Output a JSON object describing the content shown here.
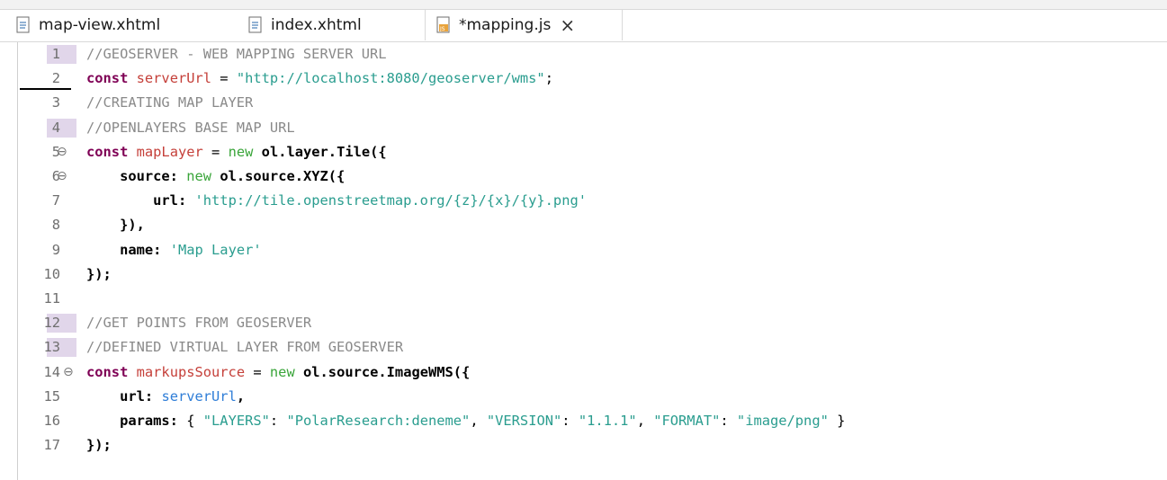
{
  "tabs": [
    {
      "label": "map-view.xhtml",
      "icon": "xhtml-file-icon",
      "active": false
    },
    {
      "label": "index.xhtml",
      "icon": "xhtml-file-icon",
      "active": false
    },
    {
      "label": "*mapping.js",
      "icon": "js-file-icon",
      "active": true,
      "close": "×"
    }
  ],
  "lines": [
    {
      "n": "1",
      "marked": true,
      "fold": "",
      "tokens": [
        {
          "t": "//GEOSERVER - WEB MAPPING SERVER URL",
          "c": "t-cmt"
        }
      ]
    },
    {
      "n": "2",
      "marked": false,
      "underline": true,
      "fold": "",
      "tokens": [
        {
          "t": "const",
          "c": "t-kw"
        },
        {
          "t": " "
        },
        {
          "t": "serverUrl",
          "c": "t-var"
        },
        {
          "t": " = "
        },
        {
          "t": "\"http://localhost:8080/geoserver/wms\"",
          "c": "t-str"
        },
        {
          "t": ";"
        }
      ]
    },
    {
      "n": "3",
      "marked": false,
      "fold": "",
      "tokens": [
        {
          "t": "//CREATING MAP LAYER",
          "c": "t-cmt"
        }
      ]
    },
    {
      "n": "4",
      "marked": true,
      "fold": "",
      "tokens": [
        {
          "t": "//OPENLAYERS BASE MAP URL",
          "c": "t-cmt"
        }
      ]
    },
    {
      "n": "5",
      "marked": false,
      "fold": "⊖",
      "tokens": [
        {
          "t": "const",
          "c": "t-kw"
        },
        {
          "t": " "
        },
        {
          "t": "mapLayer",
          "c": "t-var"
        },
        {
          "t": " = "
        },
        {
          "t": "new",
          "c": "t-new"
        },
        {
          "t": " "
        },
        {
          "t": "ol.layer.Tile({",
          "c": "t-id"
        }
      ]
    },
    {
      "n": "6",
      "marked": false,
      "fold": "⊖",
      "tokens": [
        {
          "t": "    "
        },
        {
          "t": "source:",
          "c": "t-id"
        },
        {
          "t": " "
        },
        {
          "t": "new",
          "c": "t-new"
        },
        {
          "t": " "
        },
        {
          "t": "ol.source.XYZ({",
          "c": "t-id"
        }
      ]
    },
    {
      "n": "7",
      "marked": false,
      "fold": "",
      "tokens": [
        {
          "t": "        "
        },
        {
          "t": "url:",
          "c": "t-id"
        },
        {
          "t": " "
        },
        {
          "t": "'http://tile.openstreetmap.org/{z}/{x}/{y}.png'",
          "c": "t-str"
        }
      ]
    },
    {
      "n": "8",
      "marked": false,
      "fold": "",
      "tokens": [
        {
          "t": "    "
        },
        {
          "t": "}),",
          "c": "t-id"
        }
      ]
    },
    {
      "n": "9",
      "marked": false,
      "fold": "",
      "tokens": [
        {
          "t": "    "
        },
        {
          "t": "name:",
          "c": "t-id"
        },
        {
          "t": " "
        },
        {
          "t": "'Map Layer'",
          "c": "t-str"
        }
      ]
    },
    {
      "n": "10",
      "marked": false,
      "fold": "",
      "tokens": [
        {
          "t": "});",
          "c": "t-id"
        }
      ]
    },
    {
      "n": "11",
      "marked": false,
      "fold": "",
      "tokens": []
    },
    {
      "n": "12",
      "marked": true,
      "fold": "",
      "tokens": [
        {
          "t": "//GET POINTS FROM GEOSERVER",
          "c": "t-cmt"
        }
      ]
    },
    {
      "n": "13",
      "marked": true,
      "fold": "",
      "tokens": [
        {
          "t": "//DEFINED VIRTUAL LAYER FROM GEOSERVER",
          "c": "t-cmt"
        }
      ]
    },
    {
      "n": "14",
      "marked": false,
      "fold": "⊖",
      "tokens": [
        {
          "t": "const",
          "c": "t-kw"
        },
        {
          "t": " "
        },
        {
          "t": "markupsSource",
          "c": "t-var"
        },
        {
          "t": " = "
        },
        {
          "t": "new",
          "c": "t-new"
        },
        {
          "t": " "
        },
        {
          "t": "ol.source.ImageWMS({",
          "c": "t-id"
        }
      ]
    },
    {
      "n": "15",
      "marked": false,
      "fold": "",
      "tokens": [
        {
          "t": "    "
        },
        {
          "t": "url:",
          "c": "t-id"
        },
        {
          "t": " "
        },
        {
          "t": "serverUrl",
          "c": "t-ref"
        },
        {
          "t": ",",
          "c": "t-id"
        }
      ]
    },
    {
      "n": "16",
      "marked": false,
      "fold": "",
      "tokens": [
        {
          "t": "    "
        },
        {
          "t": "params:",
          "c": "t-id"
        },
        {
          "t": " { "
        },
        {
          "t": "\"LAYERS\"",
          "c": "t-str"
        },
        {
          "t": ": "
        },
        {
          "t": "\"PolarResearch:deneme\"",
          "c": "t-str"
        },
        {
          "t": ", "
        },
        {
          "t": "\"VERSION\"",
          "c": "t-str"
        },
        {
          "t": ": "
        },
        {
          "t": "\"1.1.1\"",
          "c": "t-str"
        },
        {
          "t": ", "
        },
        {
          "t": "\"FORMAT\"",
          "c": "t-str"
        },
        {
          "t": ": "
        },
        {
          "t": "\"image/png\"",
          "c": "t-str"
        },
        {
          "t": " }"
        }
      ]
    },
    {
      "n": "17",
      "marked": false,
      "fold": "",
      "tokens": [
        {
          "t": "});",
          "c": "t-id"
        }
      ]
    }
  ]
}
